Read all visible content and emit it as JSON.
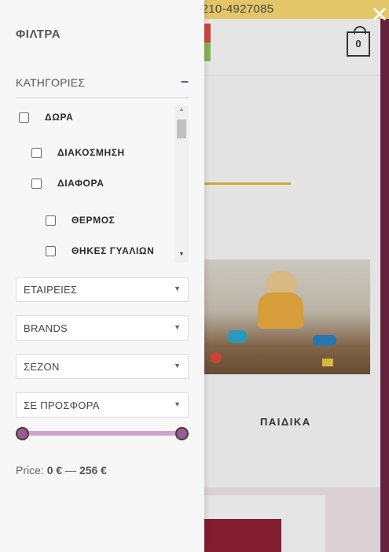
{
  "background": {
    "topbar_phone": "210-4927085",
    "cart_count": "0",
    "category_right_label": "ΠΑΙΔΙΚΑ"
  },
  "drawer": {
    "title": "ΦΙΛΤΡΑ",
    "categories": {
      "title": "ΚΑΤΗΓΟΡΙΕΣ",
      "toggle": "–",
      "items": [
        {
          "label": "ΔΩΡΑ",
          "level": 0,
          "checked": false
        },
        {
          "label": "ΔΙΑΚΟΣΜΗΣΗ",
          "level": 1,
          "checked": false
        },
        {
          "label": "ΔΙΑΦΟΡΑ",
          "level": 1,
          "checked": false
        },
        {
          "label": "ΘΕΡΜΟΣ",
          "level": 2,
          "checked": false
        },
        {
          "label": "ΘΗΚΕΣ ΓΥΑΛΙΩΝ",
          "level": 2,
          "checked": false
        }
      ]
    },
    "selects": [
      {
        "label": "ΕΤΑΙΡΕΙΕΣ"
      },
      {
        "label": "BRANDS"
      },
      {
        "label": "ΣΕΖΟΝ"
      },
      {
        "label": "ΣΕ ΠΡΟΣΦΟΡΑ"
      }
    ],
    "price": {
      "prefix": "Price:",
      "min": "0 €",
      "separator": "—",
      "max": "256 €",
      "range_min_fraction": 0,
      "range_max_fraction": 1
    }
  },
  "colors": {
    "accent": "#9b5a93",
    "track": "#d4a3cc",
    "toggle": "#2c5aa0",
    "topbar": "#f1d36e"
  },
  "icons": {
    "close": "close-icon",
    "cart": "cart-icon",
    "arrow": "chevron-down-icon"
  }
}
